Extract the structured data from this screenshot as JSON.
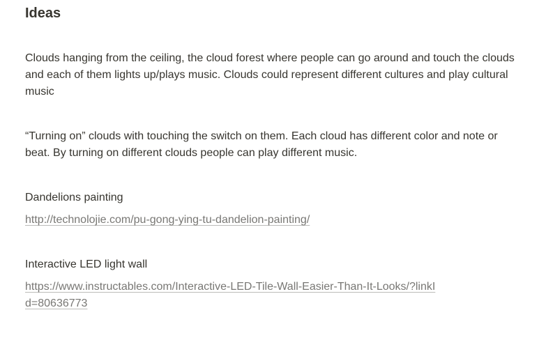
{
  "title": "Ideas",
  "paragraphs": {
    "clouds_ceiling": "Clouds hanging from the ceiling, the cloud forest where people can go around and touch the clouds and each of them lights up/plays music. Clouds could represent different cultures and play cultural music",
    "turning_on": "“Turning on” clouds with touching the switch on them. Each cloud has different color and note or beat. By turning on different clouds people can play different music.",
    "dandelions": "Dandelions painting",
    "led_wall": "Interactive LED light wall"
  },
  "links": {
    "dandelion_url": "http://technolojie.com/pu-gong-ying-tu-dandelion-painting/",
    "led_url": "https://www.instructables.com/Interactive-LED-Tile-Wall-Easier-Than-It-Looks/?linkId=80636773"
  }
}
